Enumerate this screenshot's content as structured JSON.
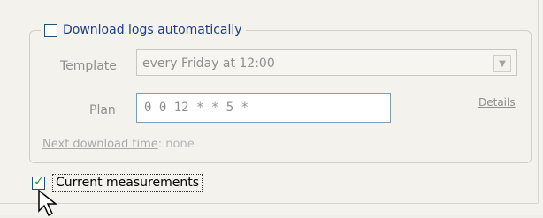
{
  "download": {
    "checkbox_label": "Download logs automatically",
    "checked": false
  },
  "template": {
    "label": "Template",
    "value": "every Friday at 12:00",
    "arrow": "chevron-down-icon"
  },
  "plan": {
    "label": "Plan",
    "value": "0 0 12 * * 5 *",
    "details_label": "Details"
  },
  "next_download": {
    "label": "Next download time",
    "value": ": none"
  },
  "current_measurements": {
    "label": "Current measurements",
    "checked": true
  },
  "colors": {
    "legend_text": "#1b3e8c",
    "checkmark": "#21a121",
    "disabled_text": "#8f8f8f"
  },
  "icons": {
    "cursor": "mouse-pointer-icon"
  }
}
